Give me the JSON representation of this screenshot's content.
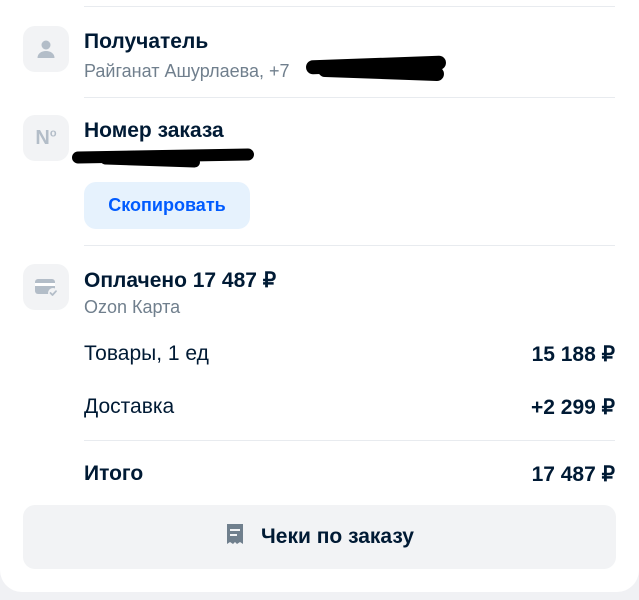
{
  "recipient": {
    "icon": "person-icon",
    "title": "Получатель",
    "details": "Райганат Ашурлаева, +7"
  },
  "order": {
    "icon": "number-sign-icon",
    "title": "Номер заказа",
    "copy_label": "Скопировать",
    "accent_color": "#005bff"
  },
  "payment": {
    "icon": "card-check-icon",
    "title": "Оплачено 17 487 ₽",
    "method": "Ozon Карта",
    "rows": [
      {
        "label": "Товары, 1 ед",
        "value": "15 188 ₽"
      },
      {
        "label": "Доставка",
        "value": "+2 299 ₽"
      }
    ],
    "total_label": "Итого",
    "total_value": "17 487 ₽"
  },
  "receipts": {
    "icon": "receipt-icon",
    "label": "Чеки по заказу"
  }
}
